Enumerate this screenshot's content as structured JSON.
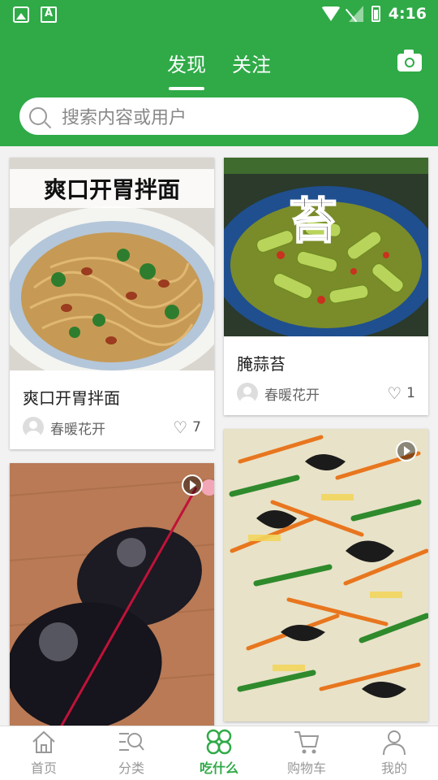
{
  "status_bar": {
    "time": "4:16"
  },
  "header": {
    "tabs": [
      {
        "label": "发现",
        "active": true
      },
      {
        "label": "关注",
        "active": false
      }
    ],
    "search_placeholder": "搜索内容或用户"
  },
  "feed": {
    "cards": [
      {
        "image_text": "爽口开胃拌面",
        "title": "爽口开胃拌面",
        "author": "春暖花开",
        "likes": "7",
        "is_video": false
      },
      {
        "image_text": "苔",
        "title": "腌蒜苔",
        "author": "春暖花开",
        "likes": "1",
        "is_video": false
      },
      {
        "is_video": true
      },
      {
        "is_video": true
      }
    ]
  },
  "tabbar": {
    "items": [
      {
        "label": "首页",
        "icon": "home-icon",
        "active": false
      },
      {
        "label": "分类",
        "icon": "category-search-icon",
        "active": false
      },
      {
        "label": "吃什么",
        "icon": "clover-icon",
        "active": true
      },
      {
        "label": "购物车",
        "icon": "cart-icon",
        "active": false
      },
      {
        "label": "我的",
        "icon": "user-icon",
        "active": false
      }
    ]
  },
  "colors": {
    "primary": "#2faa47",
    "background": "#f2f2f2"
  }
}
